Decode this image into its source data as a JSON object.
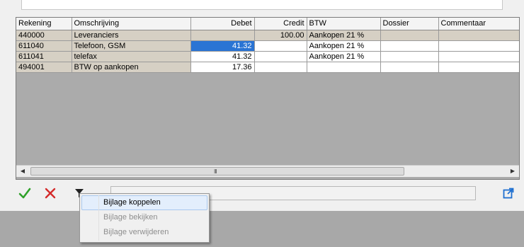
{
  "grid": {
    "columns": [
      "Rekening",
      "Omschrijving",
      "Debet",
      "Credit",
      "BTW",
      "Dossier",
      "Commentaar"
    ],
    "rows": [
      {
        "rekening": "440000",
        "omschrijving": "Leveranciers",
        "debet": "",
        "credit": "100.00",
        "btw": "Aankopen 21 %",
        "dossier": "",
        "commentaar": ""
      },
      {
        "rekening": "611040",
        "omschrijving": "Telefoon, GSM",
        "debet": "41.32",
        "credit": "",
        "btw": "Aankopen 21 %",
        "dossier": "",
        "commentaar": ""
      },
      {
        "rekening": "611041",
        "omschrijving": "telefax",
        "debet": "41.32",
        "credit": "",
        "btw": "Aankopen 21 %",
        "dossier": "",
        "commentaar": ""
      },
      {
        "rekening": "494001",
        "omschrijving": "BTW op aankopen",
        "debet": "17.36",
        "credit": "",
        "btw": "",
        "dossier": "",
        "commentaar": ""
      }
    ],
    "selected_cell": "row 2 debet",
    "scroll_grip": "III"
  },
  "toolbar": {
    "confirm_icon": "check-icon",
    "cancel_icon": "cross-icon",
    "filter_icon": "filter-icon",
    "open_icon": "external-link-icon"
  },
  "context_menu": {
    "items": [
      {
        "label": "Bijlage koppelen",
        "enabled": true
      },
      {
        "label": "Bijlage bekijken",
        "enabled": false
      },
      {
        "label": "Bijlage verwijderen",
        "enabled": false
      }
    ]
  },
  "colors": {
    "beige": "#d6d0c4",
    "selection": "#2a74d4",
    "check": "#2fa12a",
    "cross": "#d42a2a",
    "open_icon": "#1e6fd0"
  }
}
